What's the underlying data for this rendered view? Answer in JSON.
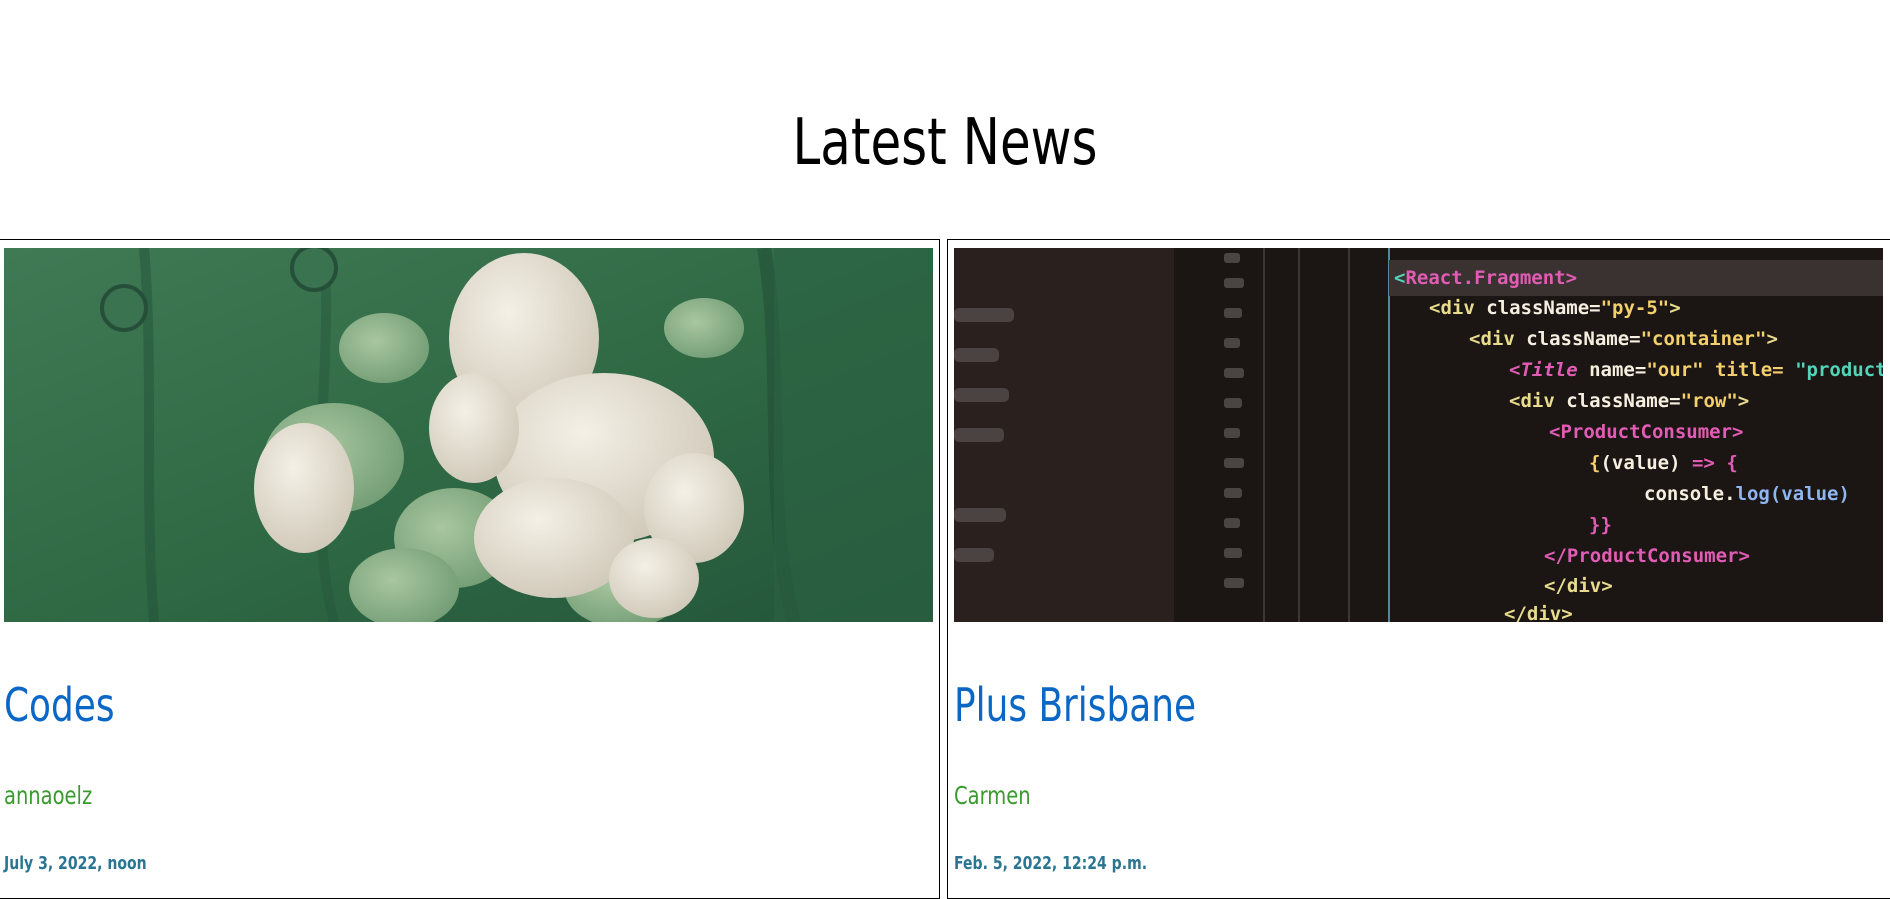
{
  "section": {
    "heading": "Latest News"
  },
  "news": [
    {
      "title": "Codes",
      "author": "annaoelz",
      "date": "July 3, 2022, noon",
      "image_icon": "flower-bouquet-photo"
    },
    {
      "title": "Plus Brisbane",
      "author": "Carmen",
      "date": "Feb. 5, 2022, 12:24 p.m.",
      "image_icon": "code-screen-photo",
      "code_lines": [
        "React.Fragment>",
        "<div className=\"py-5\">",
        "<div className=\"container\">",
        "<Title name=\"our\" title= \"product",
        "<div className=\"row\">",
        "<ProductConsumer>",
        "{(value) => {",
        "console.log(value)",
        "}}",
        "</ProductConsumer>",
        "</div>",
        "</div>"
      ]
    }
  ],
  "colors": {
    "title_link": "#0b67c6",
    "author": "#3a9a2e",
    "date": "#2a7591"
  }
}
